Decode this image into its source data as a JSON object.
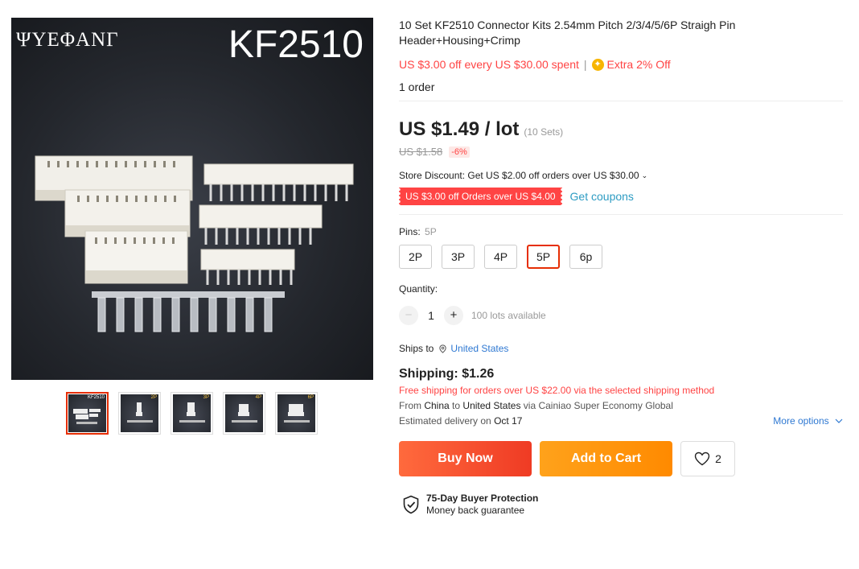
{
  "gallery": {
    "main_image": {
      "brand": "ΨYEΦANΓ",
      "model": "KF2510"
    },
    "thumbnails": [
      {
        "label": "KF2510",
        "active": true
      },
      {
        "label": "2P",
        "active": false
      },
      {
        "label": "3P",
        "active": false
      },
      {
        "label": "4P",
        "active": false
      },
      {
        "label": "6P",
        "active": false
      }
    ]
  },
  "product": {
    "title": "10 Set KF2510 Connector Kits 2.54mm Pitch 2/3/4/5/6P Straigh Pin Header+Housing+Crimp",
    "promo": "US $3.00 off every US $30.00 spent",
    "promo_separator": "|",
    "extra_off": "Extra 2% Off",
    "orders": "1 order"
  },
  "pricing": {
    "price": "US $1.49 / lot",
    "unit_note": "(10 Sets)",
    "original_price": "US $1.58",
    "discount": "-6%",
    "store_discount": "Store Discount: Get US $2.00 off orders over US $30.00",
    "coupon": "US $3.00 off Orders over US $4.00",
    "get_coupons": "Get coupons"
  },
  "sku": {
    "label": "Pins:",
    "selected_value": "5P",
    "options": [
      "2P",
      "3P",
      "4P",
      "5P",
      "6p"
    ],
    "selected_index": 3
  },
  "quantity": {
    "label": "Quantity:",
    "value": "1",
    "minus": "−",
    "plus": "+",
    "available": "100 lots available"
  },
  "shipping": {
    "ships_to_label": "Ships to",
    "country": "United States",
    "cost": "Shipping: $1.26",
    "free_note": "Free shipping for orders over US $22.00 via the selected shipping method",
    "from_prefix": "From",
    "from_country": "China",
    "to_prefix": "to",
    "to_country": "United States",
    "via": "via Cainiao Super Economy Global",
    "est_prefix": "Estimated delivery on",
    "est_date": "Oct 17",
    "more_options": "More options"
  },
  "actions": {
    "buy_now": "Buy Now",
    "add_to_cart": "Add to Cart",
    "wishlist_count": "2"
  },
  "protection": {
    "title": "75-Day Buyer Protection",
    "subtitle": "Money back guarantee"
  },
  "colors": {
    "accent_red": "#f44444",
    "buy_gradient": [
      "#ff6a3d",
      "#ef3b24"
    ],
    "cart_gradient": [
      "#ffa21b",
      "#ff8a00"
    ],
    "link_blue": "#2e78d2",
    "coupon_blue": "#2e9cc3"
  }
}
